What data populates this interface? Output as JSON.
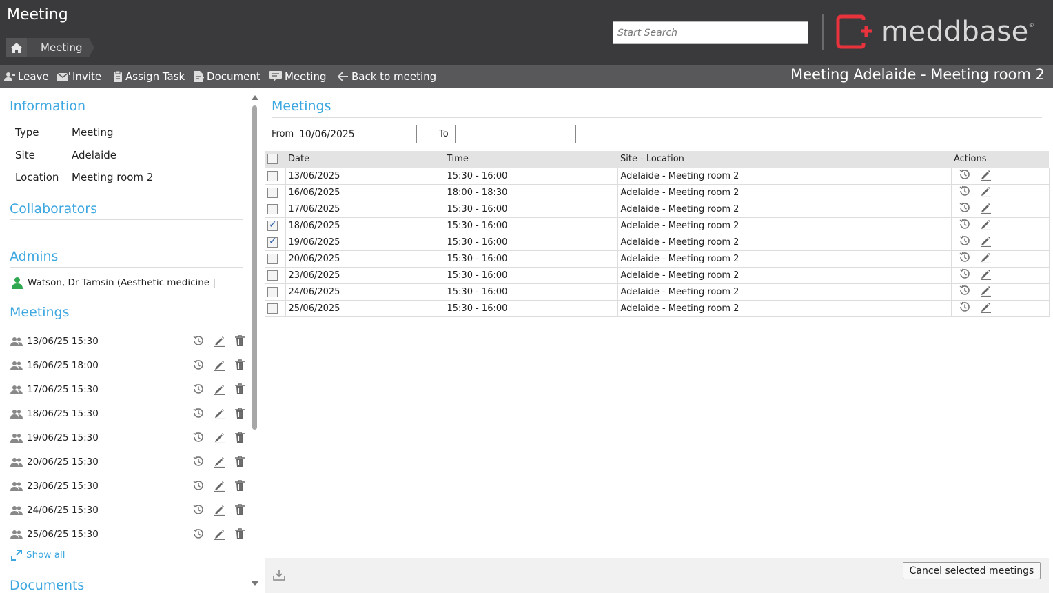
{
  "app": {
    "title": "Meeting"
  },
  "breadcrumb": {
    "items": [
      "Meeting"
    ]
  },
  "search": {
    "placeholder": "Start Search"
  },
  "logo": {
    "text": "meddbase",
    "reg": "®",
    "accent": "#e8323c"
  },
  "toolbar": {
    "items": [
      {
        "label": "Leave",
        "icon": "leave-icon"
      },
      {
        "label": "Invite",
        "icon": "invite-icon"
      },
      {
        "label": "Assign Task",
        "icon": "task-icon"
      },
      {
        "label": "Document",
        "icon": "document-icon"
      },
      {
        "label": "Meeting",
        "icon": "meeting-icon"
      },
      {
        "label": "Back to meeting",
        "icon": "arrow-left-icon"
      }
    ],
    "context_title": "Meeting Adelaide - Meeting room 2"
  },
  "left": {
    "information": {
      "heading": "Information",
      "rows": [
        {
          "label": "Type",
          "value": "Meeting"
        },
        {
          "label": "Site",
          "value": "Adelaide"
        },
        {
          "label": "Location",
          "value": "Meeting room 2"
        }
      ]
    },
    "collaborators": {
      "heading": "Collaborators"
    },
    "admins": {
      "heading": "Admins",
      "items": [
        "Watson, Dr Tamsin (Aesthetic medicine |"
      ]
    },
    "meetings": {
      "heading": "Meetings",
      "items": [
        "13/06/25 15:30",
        "16/06/25 18:00",
        "17/06/25 15:30",
        "18/06/25 15:30",
        "19/06/25 15:30",
        "20/06/25 15:30",
        "23/06/25 15:30",
        "24/06/25 15:30",
        "25/06/25 15:30"
      ],
      "show_all": "Show all"
    },
    "documents": {
      "heading": "Documents"
    }
  },
  "main": {
    "heading": "Meetings",
    "filter": {
      "from_label": "From",
      "from_value": "10/06/2025",
      "to_label": "To",
      "to_value": ""
    },
    "table": {
      "columns": [
        "Date",
        "Time",
        "Site - Location",
        "Actions"
      ],
      "rows": [
        {
          "date": "13/06/2025",
          "time": "15:30 - 16:00",
          "site": "Adelaide - Meeting room 2",
          "checked": false
        },
        {
          "date": "16/06/2025",
          "time": "18:00 - 18:30",
          "site": "Adelaide - Meeting room 2",
          "checked": false
        },
        {
          "date": "17/06/2025",
          "time": "15:30 - 16:00",
          "site": "Adelaide - Meeting room 2",
          "checked": false
        },
        {
          "date": "18/06/2025",
          "time": "15:30 - 16:00",
          "site": "Adelaide - Meeting room 2",
          "checked": true
        },
        {
          "date": "19/06/2025",
          "time": "15:30 - 16:00",
          "site": "Adelaide - Meeting room 2",
          "checked": true
        },
        {
          "date": "20/06/2025",
          "time": "15:30 - 16:00",
          "site": "Adelaide - Meeting room 2",
          "checked": false
        },
        {
          "date": "23/06/2025",
          "time": "15:30 - 16:00",
          "site": "Adelaide - Meeting room 2",
          "checked": false
        },
        {
          "date": "24/06/2025",
          "time": "15:30 - 16:00",
          "site": "Adelaide - Meeting room 2",
          "checked": false
        },
        {
          "date": "25/06/2025",
          "time": "15:30 - 16:00",
          "site": "Adelaide - Meeting room 2",
          "checked": false
        }
      ]
    },
    "cancel_button": "Cancel selected meetings"
  },
  "colors": {
    "accent": "#3da7e0",
    "header_bg": "#3a3a3c",
    "toolbar_bg": "#58585a",
    "admin_icon": "#2fa84f"
  }
}
